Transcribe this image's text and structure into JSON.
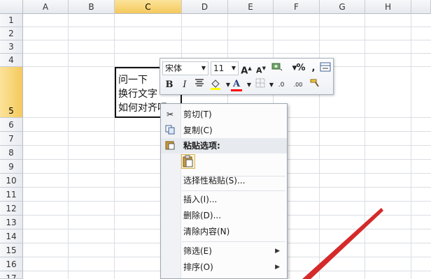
{
  "spreadsheet": {
    "columns": [
      "A",
      "B",
      "C",
      "D",
      "E",
      "F",
      "G",
      "H"
    ],
    "selected_column": "C",
    "rows": [
      "1",
      "2",
      "3",
      "4",
      "5",
      "6",
      "7",
      "8",
      "9",
      "10",
      "11",
      "12",
      "13",
      "14",
      "15",
      "16",
      "17"
    ],
    "selected_row": "5",
    "active_cell_lines": [
      "问一下",
      "换行文字",
      "如何对齐呢"
    ]
  },
  "mini_toolbar": {
    "font_name": "宋体",
    "font_size": "11",
    "grow_font": "A",
    "shrink_font": "A",
    "percent": "%",
    "comma": ",",
    "bold": "B",
    "italic": "I",
    "font_color_letter": "A",
    "increase_decimal": ".0",
    "decrease_decimal": ".00",
    "fill_color": "#ffff00",
    "font_color": "#ff0000"
  },
  "context_menu": {
    "items": [
      {
        "label": "剪切(T)",
        "icon": "scissors-icon"
      },
      {
        "label": "复制(C)",
        "icon": "copy-icon"
      },
      {
        "label": "粘贴选项:",
        "icon": "clipboard-icon"
      },
      {
        "label": "选择性粘贴(S)...",
        "icon": ""
      },
      {
        "label": "插入(I)...",
        "icon": ""
      },
      {
        "label": "删除(D)...",
        "icon": ""
      },
      {
        "label": "清除内容(N)",
        "icon": ""
      },
      {
        "label": "筛选(E)",
        "icon": "",
        "submenu": true
      },
      {
        "label": "排序(O)",
        "icon": "",
        "submenu": true
      }
    ]
  },
  "annotation": {
    "arrow_color": "#d42a2a"
  }
}
